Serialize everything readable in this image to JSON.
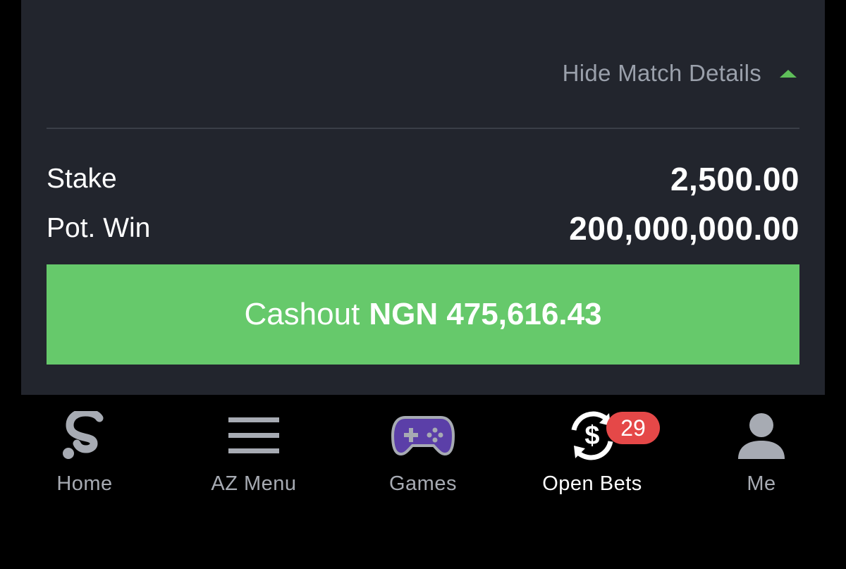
{
  "match_details": {
    "toggle_label": "Hide Match Details"
  },
  "bet": {
    "stake_label": "Stake",
    "stake_value": "2,500.00",
    "pot_win_label": "Pot. Win",
    "pot_win_value": "200,000,000.00"
  },
  "cashout": {
    "prefix": "Cashout",
    "amount": "NGN 475,616.43"
  },
  "nav": {
    "home_label": "Home",
    "az_menu_label": "AZ Menu",
    "games_label": "Games",
    "open_bets_label": "Open Bets",
    "open_bets_badge": "29",
    "me_label": "Me"
  },
  "icons": {
    "home": "sportybet-s-logo-icon",
    "az_menu": "hamburger-menu-icon",
    "games": "gamepad-icon",
    "open_bets": "cash-refresh-icon",
    "me": "user-icon"
  },
  "colors": {
    "card_bg": "#22252d",
    "accent_green": "#66c96b",
    "caret_green": "#5fbf5a",
    "badge_red": "#e54848",
    "games_purple": "#5b3fa8"
  }
}
